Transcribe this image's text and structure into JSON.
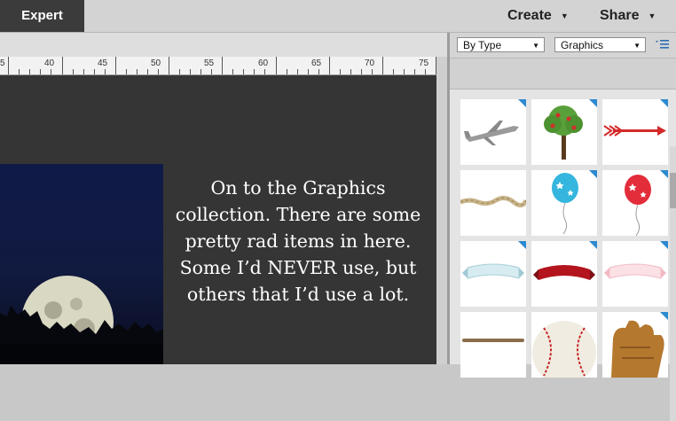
{
  "header": {
    "mode_tab": "Expert",
    "create_label": "Create",
    "share_label": "Share"
  },
  "ruler": {
    "labels": [
      "5",
      "40",
      "45",
      "50",
      "55",
      "60",
      "65",
      "70",
      "75"
    ]
  },
  "document": {
    "caption": "On to the Graphics collection. There are some pretty rad items in here. Some I’d NEVER use, but others that I’d use a lot."
  },
  "panel": {
    "filter_select": "By Type",
    "category_select": "Graphics",
    "graphics": [
      {
        "name": "airplane"
      },
      {
        "name": "apple tree"
      },
      {
        "name": "red arrow"
      },
      {
        "name": "twine"
      },
      {
        "name": "blue balloon"
      },
      {
        "name": "red balloon"
      },
      {
        "name": "blue banner"
      },
      {
        "name": "red banner"
      },
      {
        "name": "pink banner"
      },
      {
        "name": "baseball bat"
      },
      {
        "name": "baseball"
      },
      {
        "name": "baseball glove"
      }
    ]
  },
  "colors": {
    "accent": "#2b8ad0",
    "canvas_bg": "#353535",
    "tab_bg": "#3b3b3b"
  }
}
